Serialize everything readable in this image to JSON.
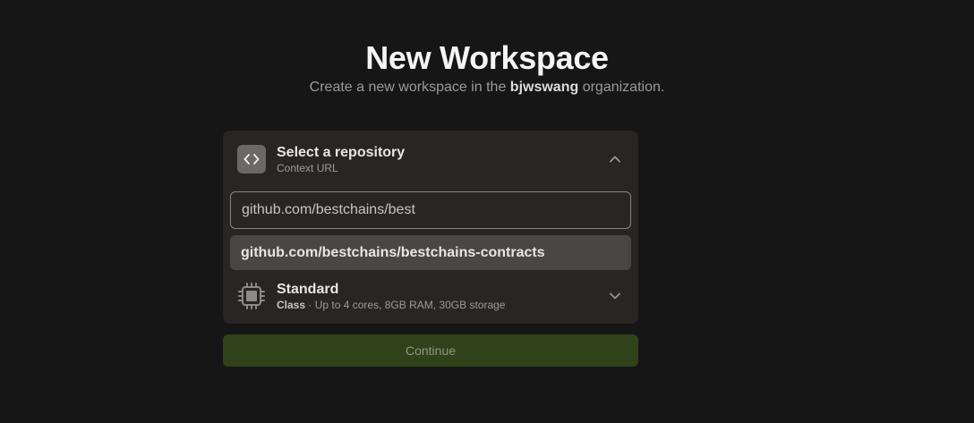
{
  "header": {
    "title": "New Workspace",
    "subtitle_prefix": "Create a new workspace in the ",
    "organization": "bjwswang",
    "subtitle_suffix": " organization."
  },
  "repository": {
    "title": "Select a repository",
    "subtitle": "Context URL",
    "icon": "code-brackets-icon",
    "expanded": true,
    "input_value": "github.com/bestchains/best",
    "suggestion": "github.com/bestchains/bestchains-contracts"
  },
  "workspace_class": {
    "title": "Standard",
    "label": "Class",
    "separator": " · ",
    "description": "Up to 4 cores, 8GB RAM, 30GB storage",
    "icon": "cpu-icon"
  },
  "actions": {
    "continue_label": "Continue"
  },
  "colors": {
    "background": "#161616",
    "card": "#292524",
    "suggestion_highlight": "#4a4645",
    "continue_button": "#2f4219"
  }
}
